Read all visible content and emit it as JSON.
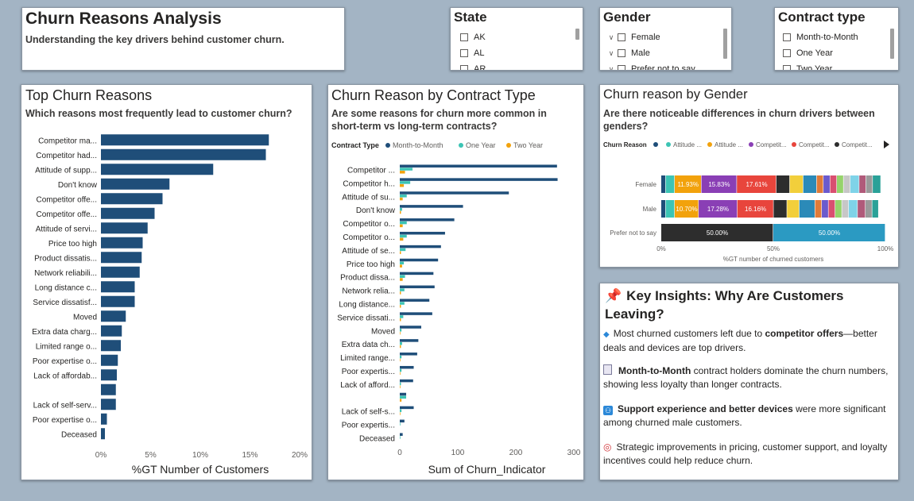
{
  "header": {
    "title": "Churn Reasons Analysis",
    "subtitle": "Understanding the key drivers behind customer churn."
  },
  "slicers": {
    "state": {
      "title": "State",
      "items": [
        "AK",
        "AL",
        "AR"
      ]
    },
    "gender": {
      "title": "Gender",
      "items": [
        "Female",
        "Male",
        "Prefer not to say"
      ]
    },
    "contract": {
      "title": "Contract type",
      "items": [
        "Month-to-Month",
        "One Year",
        "Two Year"
      ]
    }
  },
  "chart_data": [
    {
      "type": "bar",
      "orientation": "horizontal",
      "title": "Top Churn Reasons",
      "subtitle": "Which reasons most frequently lead to customer churn?",
      "xlabel": "%GT Number of Customers",
      "ylabel": "",
      "xlim": [
        0,
        20
      ],
      "ticks": [
        "0%",
        "5%",
        "10%",
        "15%",
        "20%"
      ],
      "grid": false,
      "color": "#1f4e79",
      "categories": [
        "Competitor ma...",
        "Competitor had...",
        "Attitude of supp...",
        "Don't know",
        "Competitor offe...",
        "Competitor offe...",
        "Attitude of servi...",
        "Price too high",
        "Product dissatis...",
        "Network reliabili...",
        "Long distance c...",
        "Service dissatisf...",
        "Moved",
        "Extra data charg...",
        "Limited range o...",
        "Poor expertise o...",
        "Lack of affordab...",
        "",
        "Lack of self-serv...",
        "Poor expertise o...",
        "Deceased"
      ],
      "values": [
        16.9,
        16.6,
        11.3,
        6.9,
        6.2,
        5.4,
        4.7,
        4.2,
        4.1,
        3.9,
        3.4,
        3.4,
        2.5,
        2.1,
        2.0,
        1.7,
        1.6,
        1.5,
        1.5,
        0.6,
        0.4
      ]
    },
    {
      "type": "bar",
      "orientation": "horizontal",
      "title": "Churn Reason by Contract Type",
      "subtitle": "Are some reasons for churn more common in short-term vs long-term contracts?",
      "legend_title": "Contract Type",
      "legend_position": "top-left",
      "xlabel": "Sum of Churn_Indicator",
      "ylabel": "",
      "xlim": [
        0,
        300
      ],
      "ticks": [
        "0",
        "100",
        "200",
        "300"
      ],
      "grid": false,
      "categories": [
        "Competitor ...",
        "Competitor h...",
        "Attitude of su...",
        "Don't know",
        "Competitor o...",
        "Competitor o...",
        "Attitude of se...",
        "Price too high",
        "Product dissa...",
        "Network relia...",
        "Long distance...",
        "Service dissati...",
        "Moved",
        "Extra data ch...",
        "Limited range...",
        "Poor expertis...",
        "Lack of afford...",
        "",
        "Lack of self-s...",
        "Poor expertis...",
        "Deceased"
      ],
      "series": [
        {
          "name": "Month-to-Month",
          "color": "#1f4e79",
          "values": [
            271,
            272,
            188,
            109,
            94,
            78,
            71,
            66,
            58,
            60,
            51,
            56,
            37,
            32,
            30,
            24,
            23,
            11,
            24,
            8,
            5
          ]
        },
        {
          "name": "One Year",
          "color": "#3cc4b4",
          "values": [
            22,
            18,
            12,
            4,
            12,
            12,
            10,
            7,
            9,
            8,
            8,
            6,
            3,
            4,
            3,
            3,
            2,
            11,
            3,
            1,
            1
          ]
        },
        {
          "name": "Two Year",
          "color": "#f2a20c",
          "values": [
            9,
            7,
            5,
            2,
            5,
            6,
            2,
            4,
            5,
            2,
            2,
            2,
            1,
            2,
            1,
            1,
            1,
            3,
            1,
            0,
            0
          ]
        }
      ]
    },
    {
      "type": "bar",
      "orientation": "horizontal",
      "stacked": "100%",
      "title": "Churn reason by Gender",
      "subtitle": "Are there noticeable differences in churn drivers between genders?",
      "legend_title": "Churn Reason",
      "legend_position": "top",
      "legend_items": [
        {
          "name": "",
          "color": "#1f4e79"
        },
        {
          "name": "Attitude ...",
          "color": "#3cc4b4"
        },
        {
          "name": "Attitude ...",
          "color": "#f2a20c"
        },
        {
          "name": "Competit...",
          "color": "#8a3fb5"
        },
        {
          "name": "Competit...",
          "color": "#e8453c"
        },
        {
          "name": "Competit...",
          "color": "#2d2d2d"
        }
      ],
      "xlabel": "%GT number of churned customers",
      "xlim": [
        0,
        100
      ],
      "ticks": [
        "0%",
        "50%",
        "100%"
      ],
      "categories": [
        "Female",
        "Male",
        "Prefer not to say"
      ],
      "rows": [
        {
          "label": "Female",
          "segments": [
            {
              "value": 2.0,
              "color": "#1f4e79",
              "label": ""
            },
            {
              "value": 4.0,
              "color": "#3cc4b4",
              "label": ""
            },
            {
              "value": 11.93,
              "color": "#f2a20c",
              "label": "11.93%"
            },
            {
              "value": 15.83,
              "color": "#8a3fb5",
              "label": "15.83%"
            },
            {
              "value": 17.61,
              "color": "#e8453c",
              "label": "17.61%"
            },
            {
              "value": 6.0,
              "color": "#2d2d2d",
              "label": ""
            },
            {
              "value": 6.0,
              "color": "#f2cf3b",
              "label": ""
            },
            {
              "value": 6.0,
              "color": "#2b8ab8",
              "label": ""
            },
            {
              "value": 3.0,
              "color": "#e07b39",
              "label": ""
            },
            {
              "value": 3.0,
              "color": "#6a5acd",
              "label": ""
            },
            {
              "value": 3.0,
              "color": "#d94f70",
              "label": ""
            },
            {
              "value": 3.0,
              "color": "#96d36b",
              "label": ""
            },
            {
              "value": 3.0,
              "color": "#c7c7c7",
              "label": ""
            },
            {
              "value": 4.0,
              "color": "#7fd3e8",
              "label": ""
            },
            {
              "value": 3.0,
              "color": "#b05a7a",
              "label": ""
            },
            {
              "value": 3.0,
              "color": "#9a9a9a",
              "label": ""
            },
            {
              "value": 3.63,
              "color": "#2aa198",
              "label": ""
            }
          ]
        },
        {
          "label": "Male",
          "segments": [
            {
              "value": 2.0,
              "color": "#1f4e79",
              "label": ""
            },
            {
              "value": 4.0,
              "color": "#3cc4b4",
              "label": ""
            },
            {
              "value": 10.7,
              "color": "#f2a20c",
              "label": "10.70%"
            },
            {
              "value": 17.28,
              "color": "#8a3fb5",
              "label": "17.28%"
            },
            {
              "value": 16.16,
              "color": "#e8453c",
              "label": "16.16%"
            },
            {
              "value": 6.0,
              "color": "#2d2d2d",
              "label": ""
            },
            {
              "value": 5.5,
              "color": "#f2cf3b",
              "label": ""
            },
            {
              "value": 7.0,
              "color": "#2b8ab8",
              "label": ""
            },
            {
              "value": 3.0,
              "color": "#e07b39",
              "label": ""
            },
            {
              "value": 3.0,
              "color": "#6a5acd",
              "label": ""
            },
            {
              "value": 3.0,
              "color": "#d94f70",
              "label": ""
            },
            {
              "value": 3.0,
              "color": "#96d36b",
              "label": ""
            },
            {
              "value": 3.0,
              "color": "#c7c7c7",
              "label": ""
            },
            {
              "value": 4.0,
              "color": "#7fd3e8",
              "label": ""
            },
            {
              "value": 3.5,
              "color": "#b05a7a",
              "label": ""
            },
            {
              "value": 3.0,
              "color": "#9a9a9a",
              "label": ""
            },
            {
              "value": 2.86,
              "color": "#2aa198",
              "label": ""
            }
          ]
        },
        {
          "label": "Prefer not to say",
          "segments": [
            {
              "value": 50.0,
              "color": "#2d2d2d",
              "label": "50.00%"
            },
            {
              "value": 50.0,
              "color": "#2b9ac2",
              "label": "50.00%"
            }
          ]
        }
      ]
    }
  ],
  "insights": {
    "title": "Key Insights: Why Are Customers Leaving?",
    "items": [
      {
        "pre": "Most churned customers left due to ",
        "bold": "competitor offers",
        "post": "—better deals and devices are top drivers."
      },
      {
        "pre": "",
        "bold": "Month-to-Month",
        "post": " contract holders dominate the churn numbers, showing less loyalty than longer contracts."
      },
      {
        "pre": "",
        "bold": "Support experience and better devices",
        "post": " were more significant among churned male customers."
      },
      {
        "pre": "",
        "bold": "",
        "post": "Strategic improvements in pricing, customer support, and loyalty incentives could help reduce churn."
      }
    ]
  },
  "icons": {
    "insights": "pushpin-icon",
    "insight_1": "diamond-icon",
    "insight_2": "clipboard-icon",
    "insight_3": "person-icon",
    "insight_4": "target-icon"
  }
}
